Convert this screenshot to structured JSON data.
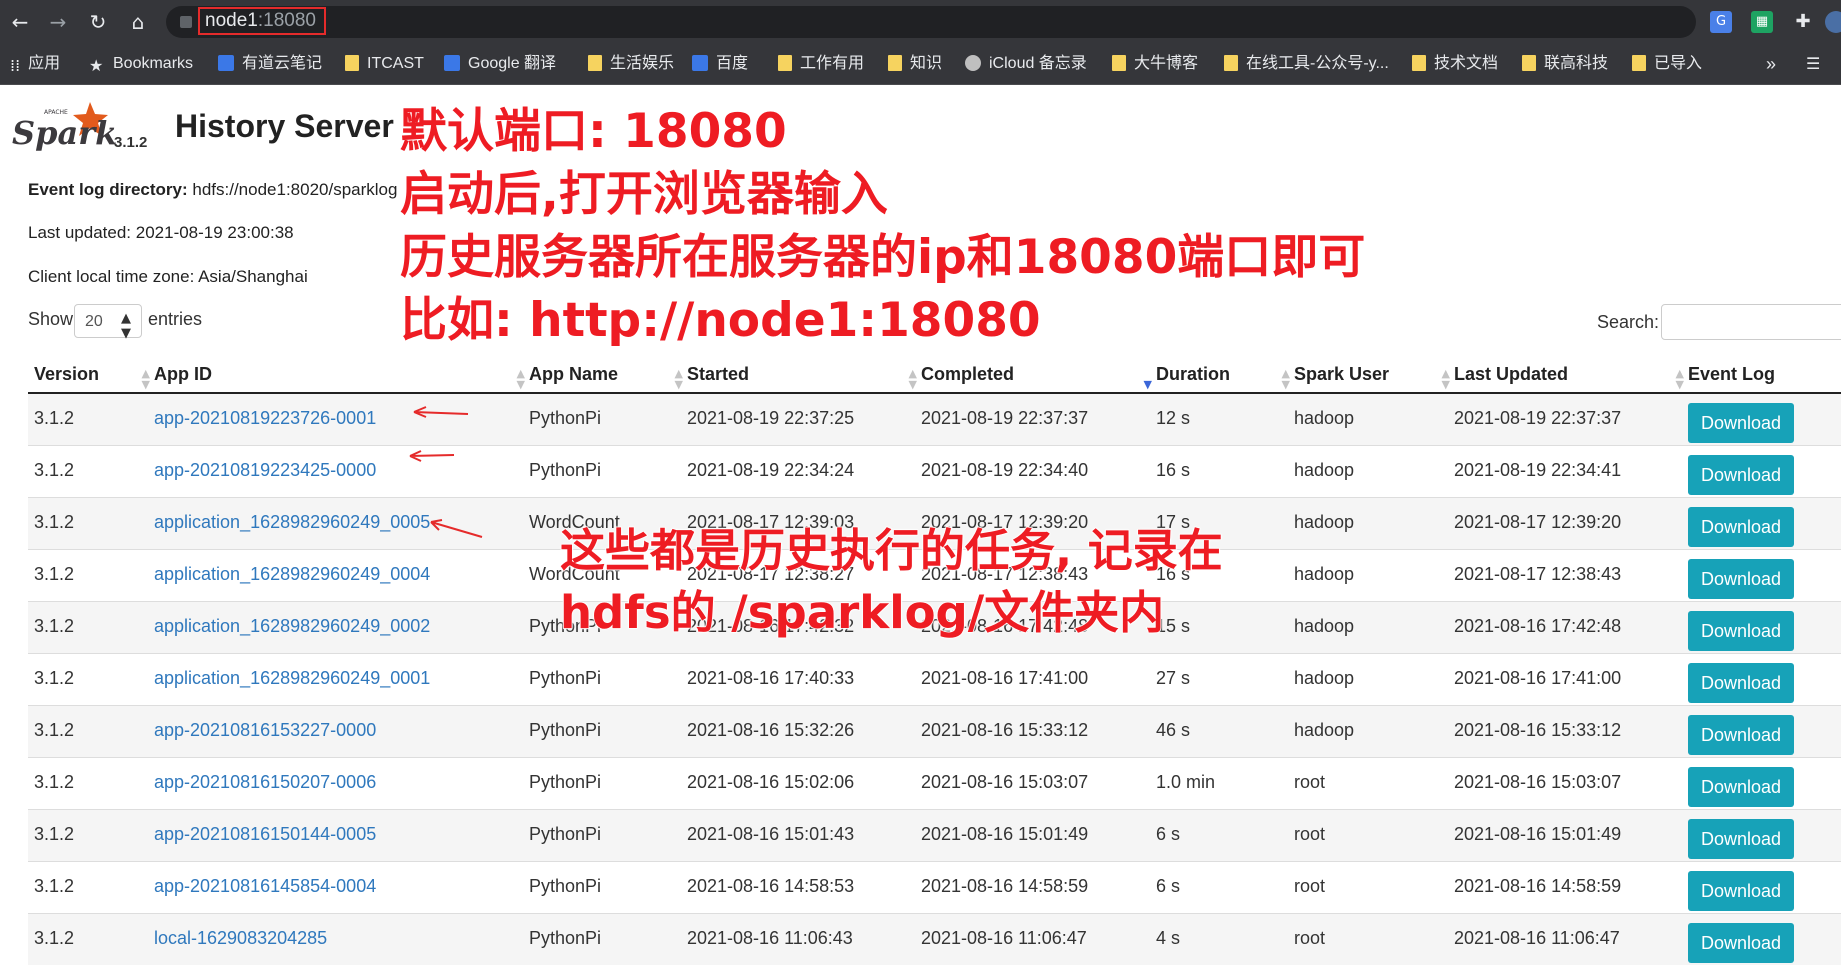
{
  "browser": {
    "url_host": "node1",
    "url_port": ":18080",
    "bookmarks": [
      {
        "label": "应用",
        "icon": "apps-grid-icon"
      },
      {
        "label": "Bookmarks",
        "icon": "star-icon"
      },
      {
        "label": "有道云笔记",
        "icon": "youdao-note-icon"
      },
      {
        "label": "ITCAST",
        "icon": "folder-icon"
      },
      {
        "label": "Google 翻译",
        "icon": "google-translate-icon"
      },
      {
        "label": "生活娱乐",
        "icon": "folder-icon"
      },
      {
        "label": "百度",
        "icon": "baidu-icon"
      },
      {
        "label": "工作有用",
        "icon": "folder-icon"
      },
      {
        "label": "知识",
        "icon": "folder-icon"
      },
      {
        "label": "iCloud 备忘录",
        "icon": "apple-icon"
      },
      {
        "label": "大牛博客",
        "icon": "folder-icon"
      },
      {
        "label": "在线工具-公众号-y...",
        "icon": "folder-icon"
      },
      {
        "label": "技术文档",
        "icon": "folder-icon"
      },
      {
        "label": "联高科技",
        "icon": "folder-icon"
      },
      {
        "label": "已导入",
        "icon": "folder-icon"
      }
    ],
    "overflow": "»"
  },
  "spark": {
    "version": "3.1.2",
    "title": "History Server",
    "event_log_label": "Event log directory:",
    "event_log_value": "hdfs://node1:8020/sparklog",
    "last_updated": "Last updated: 2021-08-19 23:00:38",
    "timezone": "Client local time zone: Asia/Shanghai"
  },
  "controls": {
    "show_label": "Show",
    "entries_value": "20",
    "entries_label": "entries",
    "search_label": "Search:",
    "search_value": ""
  },
  "table": {
    "headers": [
      "Version",
      "App ID",
      "App Name",
      "Started",
      "Completed",
      "Duration",
      "Spark User",
      "Last Updated",
      "Event Log"
    ],
    "rows": [
      [
        "3.1.2",
        "app-20210819223726-0001",
        "PythonPi",
        "2021-08-19 22:37:25",
        "2021-08-19 22:37:37",
        "12 s",
        "hadoop",
        "2021-08-19 22:37:37",
        "Download"
      ],
      [
        "3.1.2",
        "app-20210819223425-0000",
        "PythonPi",
        "2021-08-19 22:34:24",
        "2021-08-19 22:34:40",
        "16 s",
        "hadoop",
        "2021-08-19 22:34:41",
        "Download"
      ],
      [
        "3.1.2",
        "application_1628982960249_0005",
        "WordCount",
        "2021-08-17 12:39:03",
        "2021-08-17 12:39:20",
        "17 s",
        "hadoop",
        "2021-08-17 12:39:20",
        "Download"
      ],
      [
        "3.1.2",
        "application_1628982960249_0004",
        "WordCount",
        "2021-08-17 12:38:27",
        "2021-08-17 12:38:43",
        "16 s",
        "hadoop",
        "2021-08-17 12:38:43",
        "Download"
      ],
      [
        "3.1.2",
        "application_1628982960249_0002",
        "PythonPi",
        "2021-08-16 17:42:32",
        "2021-08-16 17:42:48",
        "15 s",
        "hadoop",
        "2021-08-16 17:42:48",
        "Download"
      ],
      [
        "3.1.2",
        "application_1628982960249_0001",
        "PythonPi",
        "2021-08-16 17:40:33",
        "2021-08-16 17:41:00",
        "27 s",
        "hadoop",
        "2021-08-16 17:41:00",
        "Download"
      ],
      [
        "3.1.2",
        "app-20210816153227-0000",
        "PythonPi",
        "2021-08-16 15:32:26",
        "2021-08-16 15:33:12",
        "46 s",
        "hadoop",
        "2021-08-16 15:33:12",
        "Download"
      ],
      [
        "3.1.2",
        "app-20210816150207-0006",
        "PythonPi",
        "2021-08-16 15:02:06",
        "2021-08-16 15:03:07",
        "1.0 min",
        "root",
        "2021-08-16 15:03:07",
        "Download"
      ],
      [
        "3.1.2",
        "app-20210816150144-0005",
        "PythonPi",
        "2021-08-16 15:01:43",
        "2021-08-16 15:01:49",
        "6 s",
        "root",
        "2021-08-16 15:01:49",
        "Download"
      ],
      [
        "3.1.2",
        "app-20210816145854-0004",
        "PythonPi",
        "2021-08-16 14:58:53",
        "2021-08-16 14:58:59",
        "6 s",
        "root",
        "2021-08-16 14:58:59",
        "Download"
      ],
      [
        "3.1.2",
        "local-1629083204285",
        "PythonPi",
        "2021-08-16 11:06:43",
        "2021-08-16 11:06:47",
        "4 s",
        "root",
        "2021-08-16 11:06:47",
        "Download"
      ]
    ]
  },
  "annotations": {
    "line1": "默认端口: 18080",
    "line2": "启动后,打开浏览器输入",
    "line3": "历史服务器所在服务器的ip和18080端口即可",
    "line4": "比如: http://node1:18080",
    "line5": "这些都是历史执行的任务, 记录在",
    "line6": "hdfs的 /sparklog/文件夹内"
  },
  "colors": {
    "chrome_bg": "#35363a",
    "link": "#2f78bd",
    "download_btn": "#17a2b8",
    "annotation": "#ee1c23"
  }
}
